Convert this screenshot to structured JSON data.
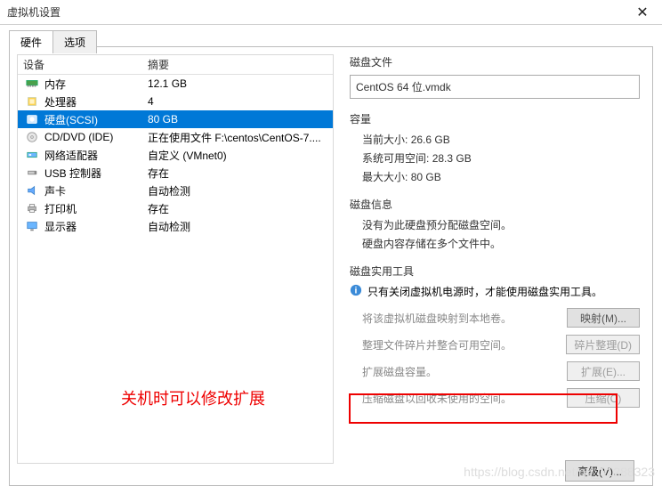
{
  "window": {
    "title": "虚拟机设置"
  },
  "tabs": {
    "hardware": "硬件",
    "options": "选项"
  },
  "table": {
    "device": "设备",
    "summary": "摘要"
  },
  "devices": {
    "memory": {
      "name": "内存",
      "summary": "12.1 GB"
    },
    "cpu": {
      "name": "处理器",
      "summary": "4"
    },
    "disk": {
      "name": "硬盘(SCSI)",
      "summary": "80 GB"
    },
    "cd": {
      "name": "CD/DVD (IDE)",
      "summary": "正在使用文件 F:\\centos\\CentOS-7...."
    },
    "net": {
      "name": "网络适配器",
      "summary": "自定义 (VMnet0)"
    },
    "usb": {
      "name": "USB 控制器",
      "summary": "存在"
    },
    "sound": {
      "name": "声卡",
      "summary": "自动检测"
    },
    "printer": {
      "name": "打印机",
      "summary": "存在"
    },
    "display": {
      "name": "显示器",
      "summary": "自动检测"
    }
  },
  "right": {
    "diskfile_title": "磁盘文件",
    "diskfile_value": "CentOS 64 位.vmdk",
    "capacity_title": "容量",
    "current_size_label": "当前大小:",
    "current_size_value": "26.6 GB",
    "free_label": "系统可用空间:",
    "free_value": "28.3 GB",
    "max_label": "最大大小:",
    "max_value": "80 GB",
    "diskinfo_title": "磁盘信息",
    "diskinfo_line1": "没有为此硬盘预分配磁盘空间。",
    "diskinfo_line2": "硬盘内容存储在多个文件中。",
    "tools_title": "磁盘实用工具",
    "power_hint": "只有关闭虚拟机电源时，才能使用磁盘实用工具。",
    "map_label": "将该虚拟机磁盘映射到本地卷。",
    "map_btn": "映射(M)...",
    "defrag_label": "整理文件碎片并整合可用空间。",
    "defrag_btn": "碎片整理(D)",
    "expand_label": "扩展磁盘容量。",
    "expand_btn": "扩展(E)...",
    "compress_label": "压缩磁盘以回收未使用的空间。",
    "compress_btn": "压缩(C)"
  },
  "annotation": "关机时可以修改扩展",
  "footer": {
    "advanced": "高级(V)..."
  },
  "watermark": "https://blog.csdn.net/qq_31288323"
}
